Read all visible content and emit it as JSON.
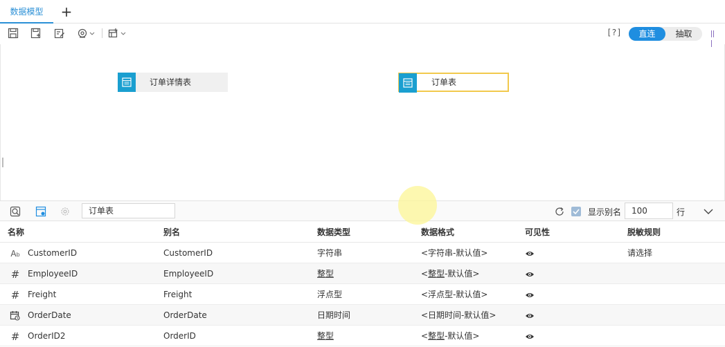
{
  "tabs": [
    {
      "label": "数据模型"
    }
  ],
  "toolbar": {
    "help_label": "[?]",
    "mode_direct": "直连",
    "mode_extract": "抽取"
  },
  "canvas": {
    "nodes": [
      {
        "label": "订单详情表",
        "selected": false
      },
      {
        "label": "订单表",
        "selected": true
      }
    ]
  },
  "panel": {
    "table_name": "订单表",
    "show_alias_label": "显示别名",
    "show_alias_checked": true,
    "row_count": "100",
    "row_unit": "行"
  },
  "table": {
    "headers": [
      "名称",
      "别名",
      "数据类型",
      "数据格式",
      "可见性",
      "脱敏规则"
    ],
    "rows": [
      {
        "type_icon": "text-type-icon",
        "name": "CustomerID",
        "alias": "CustomerID",
        "datatype": "字符串",
        "format": "<字符串-默认值>",
        "visible": true,
        "mask": "请选择"
      },
      {
        "type_icon": "number-type-icon",
        "name": "EmployeeID",
        "alias": "EmployeeID",
        "datatype": "整型",
        "format": "<整型-默认值>",
        "visible": true,
        "mask": ""
      },
      {
        "type_icon": "number-type-icon",
        "name": "Freight",
        "alias": "Freight",
        "datatype": "浮点型",
        "format": "<浮点型-默认值>",
        "visible": true,
        "mask": ""
      },
      {
        "type_icon": "date-type-icon",
        "name": "OrderDate",
        "alias": "OrderDate",
        "datatype": "日期时间",
        "format": "<日期时间-默认值>",
        "visible": true,
        "mask": ""
      },
      {
        "type_icon": "number-type-icon",
        "name": "OrderID2",
        "alias": "OrderID",
        "datatype": "整型",
        "format": "<整型-默认值>",
        "visible": true,
        "mask": ""
      }
    ]
  },
  "colors": {
    "accent": "#1f8ee0",
    "node_icon": "#1a9fd0",
    "selected_border": "#f2c94c"
  }
}
